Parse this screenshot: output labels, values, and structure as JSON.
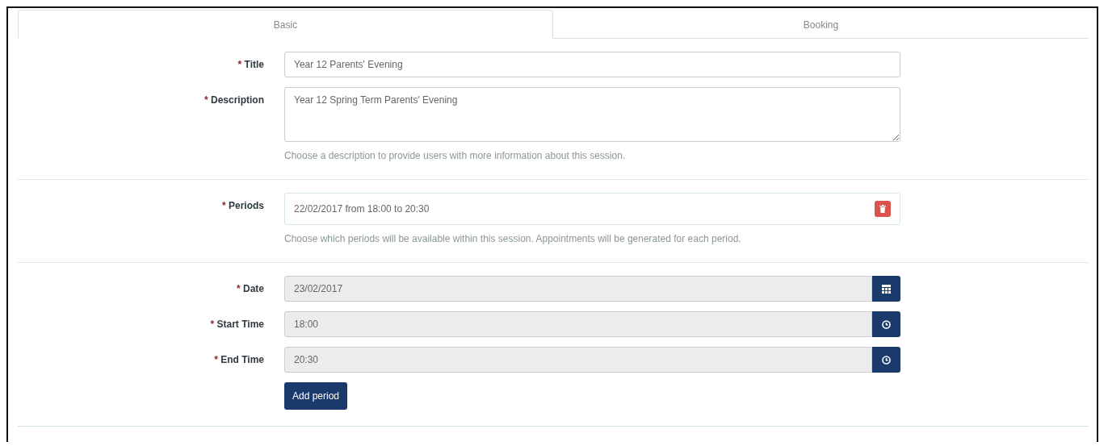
{
  "tabs": [
    {
      "label": "Basic",
      "selected": true
    },
    {
      "label": "Booking",
      "selected": false
    }
  ],
  "sections": [
    {
      "rows": [
        {
          "kind": "input",
          "marker": "*",
          "label": "Title",
          "value": "Year 12 Parents' Evening"
        },
        {
          "kind": "textarea",
          "marker": "*",
          "label": "Description",
          "value": "Year 12 Spring Term Parents' Evening",
          "help": "Choose a description to provide users with more information about this session."
        }
      ]
    },
    {
      "rows": [
        {
          "kind": "list",
          "marker": "*",
          "label": "Periods",
          "items": [
            {
              "text": "22/02/2017 from 18:00 to 20:30"
            }
          ],
          "help": "Choose which periods will be available within this session. Appointments will be generated for each period."
        }
      ]
    },
    {
      "rows": [
        {
          "kind": "date",
          "marker": "*",
          "label": "Date",
          "value": "23/02/2017",
          "disabled": true
        },
        {
          "kind": "time",
          "marker": "*",
          "label": "Start Time",
          "value": "18:00",
          "disabled": true
        },
        {
          "kind": "time",
          "marker": "*",
          "label": "End Time",
          "value": "20:30",
          "disabled": true
        },
        {
          "kind": "button",
          "label": "Add period"
        }
      ]
    }
  ]
}
